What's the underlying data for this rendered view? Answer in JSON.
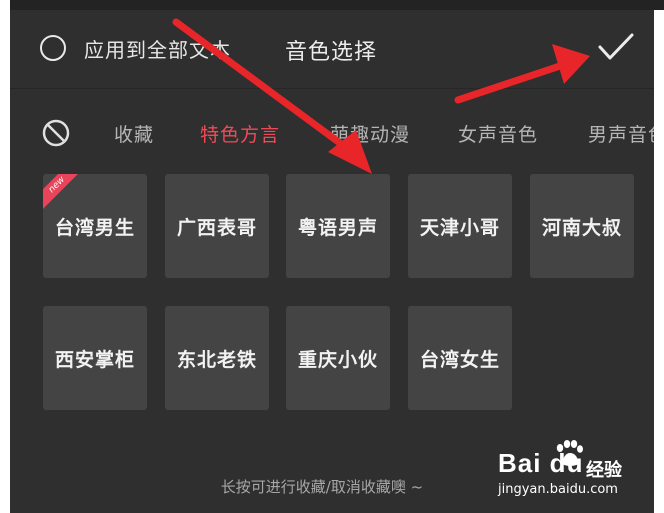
{
  "header": {
    "apply_all_label": "应用到全部文本",
    "title": "音色选择",
    "confirm_icon": "checkmark-icon"
  },
  "tabs": [
    {
      "label": "收藏",
      "active": false
    },
    {
      "label": "特色方言",
      "active": true
    },
    {
      "label": "萌趣动漫",
      "active": false
    },
    {
      "label": "女声音色",
      "active": false
    },
    {
      "label": "男声音色",
      "active": false
    }
  ],
  "voices": [
    {
      "label": "台湾男生",
      "new": true
    },
    {
      "label": "广西表哥",
      "new": false
    },
    {
      "label": "粤语男声",
      "new": false
    },
    {
      "label": "天津小哥",
      "new": false
    },
    {
      "label": "河南大叔",
      "new": false
    },
    {
      "label": "西安掌柜",
      "new": false
    },
    {
      "label": "东北老铁",
      "new": false
    },
    {
      "label": "重庆小伙",
      "new": false
    },
    {
      "label": "台湾女生",
      "new": false
    }
  ],
  "badge_new": "new",
  "hint": "长按可进行收藏/取消收藏噢 ~",
  "watermark": {
    "brand": "Bai du",
    "jingyan": "经验",
    "url": "jingyan.baidu.com"
  },
  "colors": {
    "panel_bg": "#2f2f2f",
    "card_bg": "#444444",
    "accent": "#f04a57",
    "annotation_arrow": "#e8262a"
  }
}
